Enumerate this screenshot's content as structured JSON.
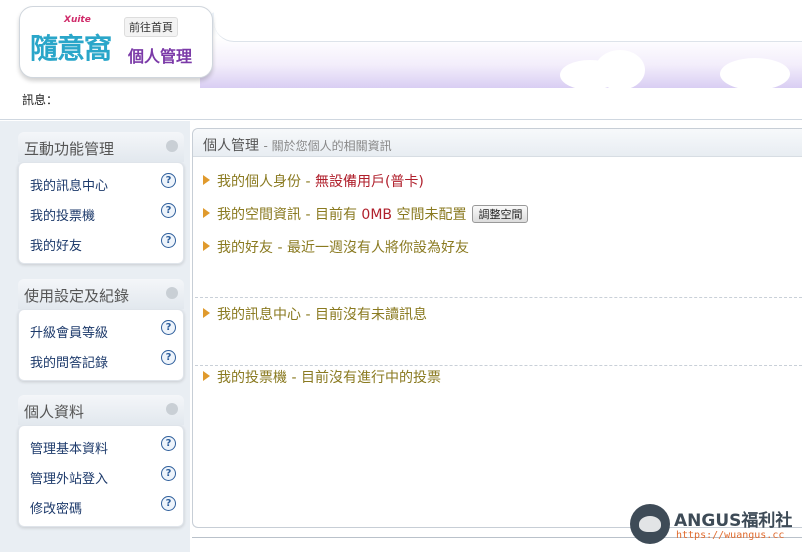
{
  "header": {
    "brand_small": "Xuite",
    "brand_main": "隨意窩",
    "home_link": "前往首頁",
    "section_title": "個人管理",
    "message_label": "訊息："
  },
  "sidebar": {
    "sections": [
      {
        "title": "互動功能管理",
        "items": [
          {
            "label": "我的訊息中心"
          },
          {
            "label": "我的投票機"
          },
          {
            "label": "我的好友"
          }
        ]
      },
      {
        "title": "使用設定及紀錄",
        "items": [
          {
            "label": "升級會員等級"
          },
          {
            "label": "我的問答記錄"
          }
        ]
      },
      {
        "title": "個人資料",
        "items": [
          {
            "label": "管理基本資料"
          },
          {
            "label": "管理外站登入"
          },
          {
            "label": "修改密碼"
          }
        ]
      }
    ],
    "help_glyph": "?"
  },
  "main": {
    "title": "個人管理",
    "subtitle": "- 關於您個人的相關資訊",
    "rows": {
      "identity": {
        "label": "我的個人身份",
        "sep": " - ",
        "value": "無設備用戶(普卡)"
      },
      "space": {
        "label": "我的空間資訊",
        "sep": " - ",
        "prefix": "目前有 ",
        "amount": "0MB",
        "suffix": " 空間未配置",
        "button": "調整空間"
      },
      "friends": {
        "label": "我的好友",
        "sep": " - ",
        "value": "最近一週沒有人將你設為好友"
      },
      "messages": {
        "label": "我的訊息中心",
        "sep": " - ",
        "value": "目前沒有未讀訊息"
      },
      "votes": {
        "label": "我的投票機",
        "sep": " - ",
        "value": "目前沒有進行中的投票"
      }
    }
  },
  "watermark": {
    "title": "ANGUS福利社",
    "url": "https://wuangus.cc"
  },
  "colors": {
    "link": "#1d3a6b",
    "row_text": "#8a7a20",
    "highlight": "#b0202c",
    "arrow": "#e09a2c",
    "brand_blue": "#2aa6c9",
    "brand_purple": "#7b3aa8"
  }
}
